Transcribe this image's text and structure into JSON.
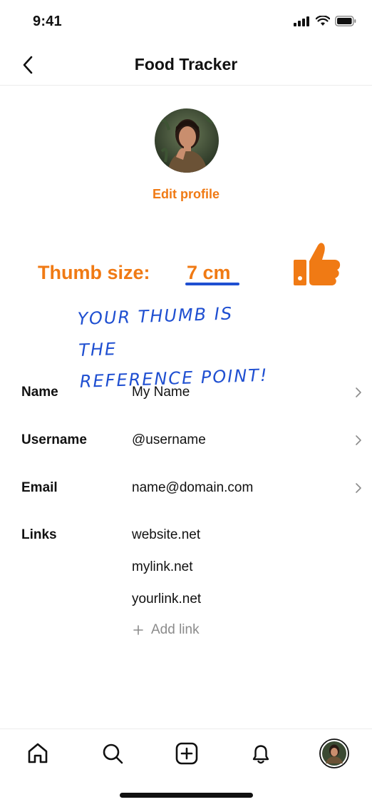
{
  "status_bar": {
    "time": "9:41"
  },
  "header": {
    "title": "Food Tracker"
  },
  "profile": {
    "edit_label": "Edit profile"
  },
  "thumb": {
    "label": "Thumb size:",
    "value": "7 cm"
  },
  "annotation": {
    "line1": "YOUR THUMB IS THE",
    "line2": "REFERENCE POINT!"
  },
  "fields": {
    "name": {
      "label": "Name",
      "value": "My Name"
    },
    "username": {
      "label": "Username",
      "value": "@username"
    },
    "email": {
      "label": "Email",
      "value": "name@domain.com"
    },
    "links": {
      "label": "Links",
      "items": [
        "website.net",
        "mylink.net",
        "yourlink.net"
      ],
      "add_label": "Add link"
    }
  },
  "colors": {
    "accent": "#f07a14",
    "annotation": "#1f4fd1",
    "text": "#111111",
    "muted": "#8b8b8b"
  },
  "icons": [
    "back-chevron-icon",
    "thumbs-up-icon",
    "chevron-right-icon",
    "plus-icon",
    "home-icon",
    "search-icon",
    "add-square-icon",
    "bell-icon",
    "profile-avatar"
  ]
}
